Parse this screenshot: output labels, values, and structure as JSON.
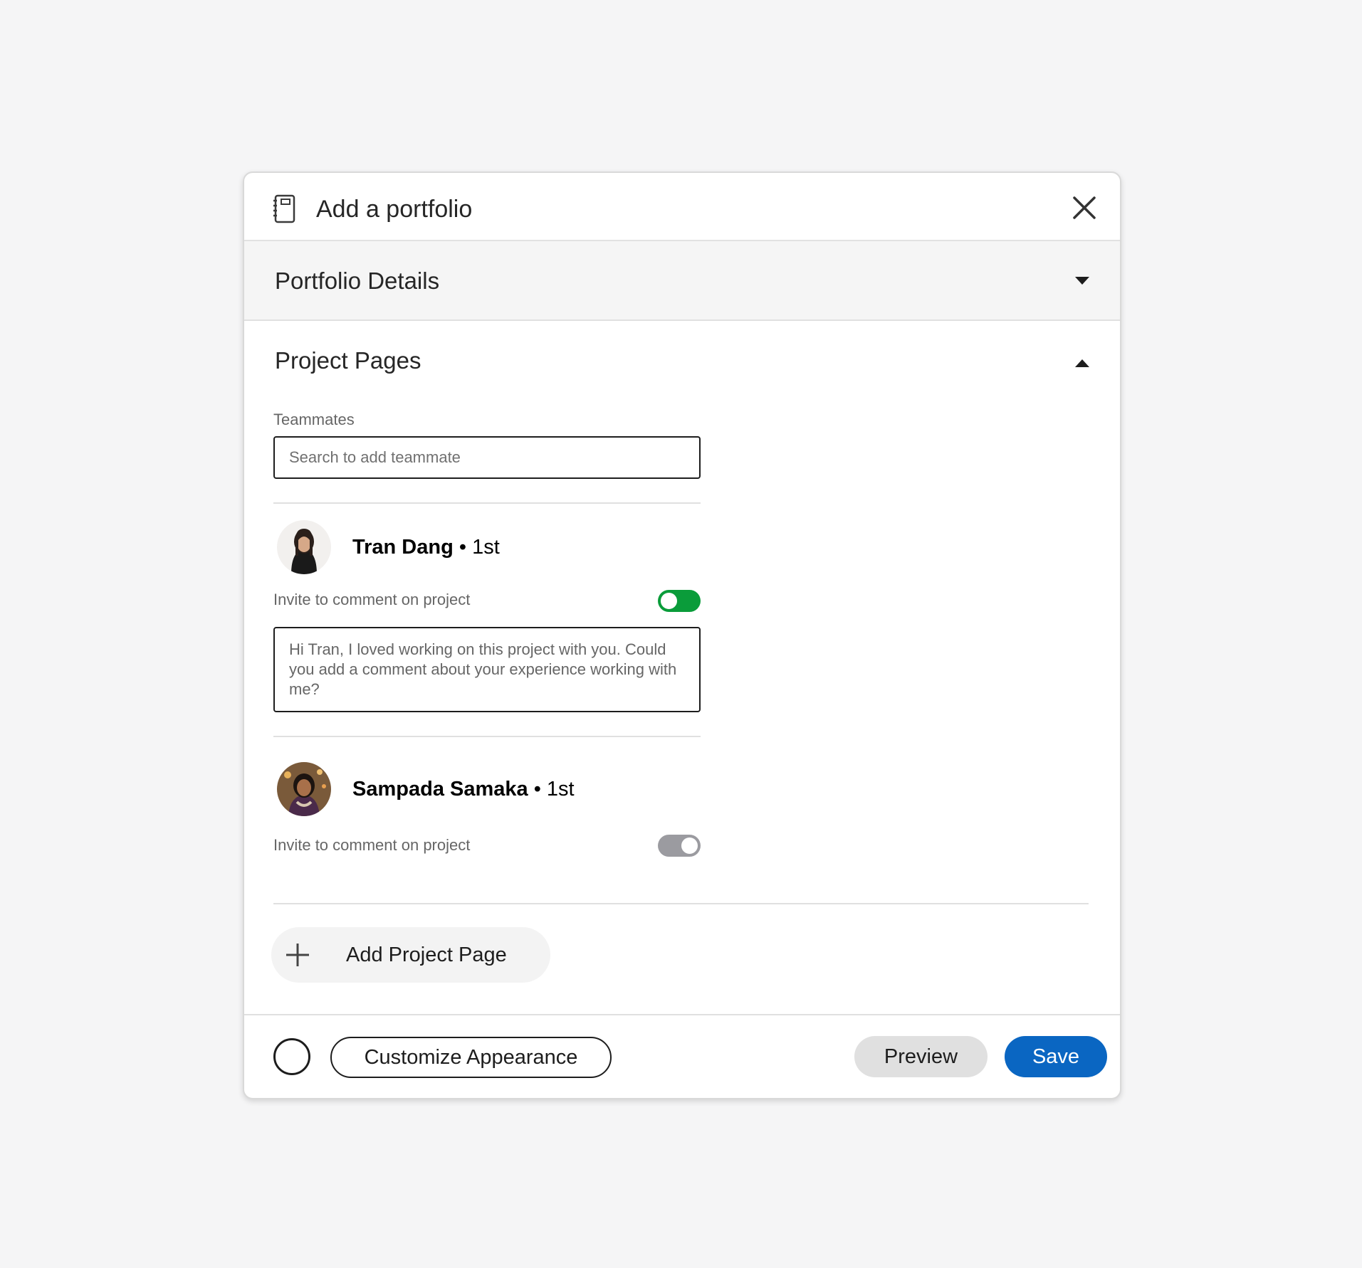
{
  "modal": {
    "title": "Add a portfolio",
    "header_icon": "portfolio-notebook-icon",
    "close_icon": "close-icon"
  },
  "sections": {
    "details": {
      "title": "Portfolio Details",
      "state": "collapsed"
    },
    "project_pages": {
      "title": "Project Pages",
      "state": "expanded",
      "teammates_label": "Teammates",
      "search_placeholder": "Search to add teammate"
    }
  },
  "teammates": [
    {
      "name": "Tran Dang",
      "degree": "• 1st",
      "invite_label": "Invite to comment on project",
      "invite_enabled": true,
      "message": "Hi Tran, I loved working on this project with you. Could you add a comment about your experience working with me?"
    },
    {
      "name": "Sampada Samaka",
      "degree": "• 1st",
      "invite_label": "Invite to comment on project",
      "invite_enabled": false
    }
  ],
  "add_project_page": {
    "label": "Add Project Page",
    "icon": "plus-icon"
  },
  "footer": {
    "customize_label": "Customize Appearance",
    "preview_label": "Preview",
    "save_label": "Save"
  },
  "colors": {
    "background": "#f5f5f6",
    "accent_blue": "#0a66c2",
    "toggle_on": "#0a9c3a",
    "toggle_off": "#9b9ba0"
  }
}
